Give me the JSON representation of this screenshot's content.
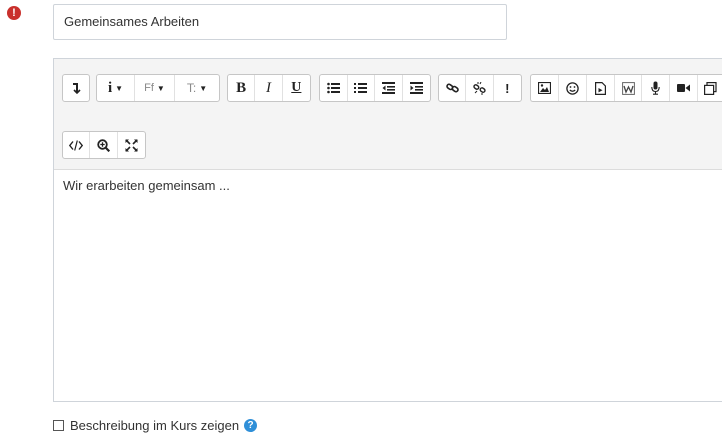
{
  "form": {
    "required_icon": "exclamation-icon",
    "name_value": "Gemeinsames Arbeiten"
  },
  "editor": {
    "content": "Wir erarbeiten gemeinsam ...",
    "toolbar": {
      "row1": [
        "collapse-icon",
        "info-style-icon",
        "font-family-icon",
        "font-size-icon",
        "bold-icon",
        "italic-icon",
        "underline-icon",
        "bullet-list-icon",
        "numbered-list-icon",
        "outdent-icon",
        "indent-icon",
        "link-icon",
        "unlink-icon",
        "no-autolink-icon",
        "image-icon",
        "emoticon-icon",
        "media-icon",
        "wiris-icon",
        "record-audio-icon",
        "record-video-icon",
        "manage-files-icon"
      ],
      "row2": [
        "html-icon",
        "zoom-icon",
        "fullscreen-icon"
      ],
      "bold_label": "B",
      "italic_label": "I",
      "underline_label": "U",
      "info_label": "i",
      "font_label": "Ff",
      "size_label": "T:",
      "exclaim_label": "!"
    }
  },
  "footer": {
    "checkbox_label": "Beschreibung im Kurs zeigen",
    "help_icon": "question-icon",
    "help_label": "?"
  }
}
